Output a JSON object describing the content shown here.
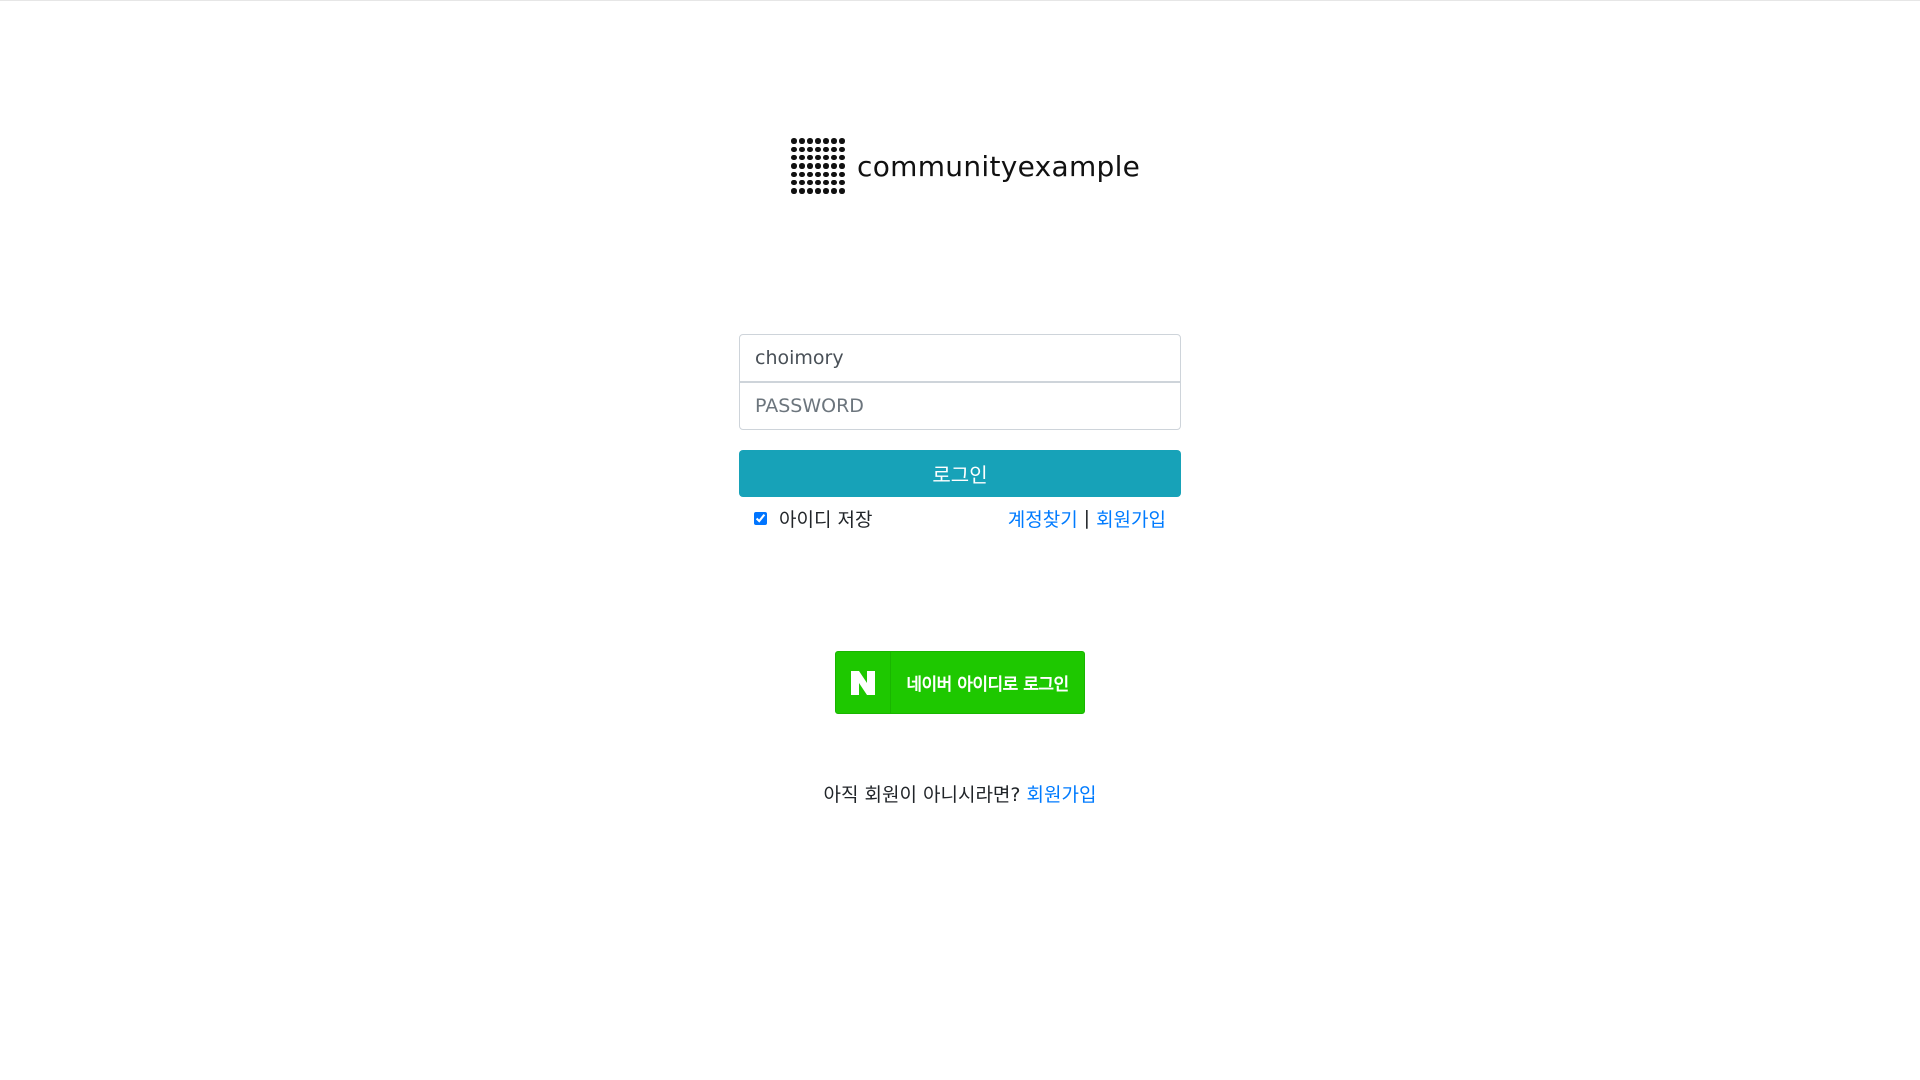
{
  "logo": {
    "text": "communityexample",
    "icon": "dot-grid-icon"
  },
  "login_form": {
    "username_value": "choimory",
    "password_placeholder": "PASSWORD",
    "login_button_label": "로그인",
    "remember_label": "아이디 저장",
    "remember_checked": true,
    "find_account_label": "계정찾기",
    "separator": "|",
    "signup_link_label": "회원가입"
  },
  "naver_login": {
    "label": "네이버 아이디로 로그인",
    "icon": "naver-n-icon",
    "color": "#1ec800"
  },
  "signup_prompt": {
    "text": "아직 회원이 아니시라면? ",
    "link_label": "회원가입"
  },
  "colors": {
    "accent": "#17a2b8",
    "link": "#007bff"
  }
}
